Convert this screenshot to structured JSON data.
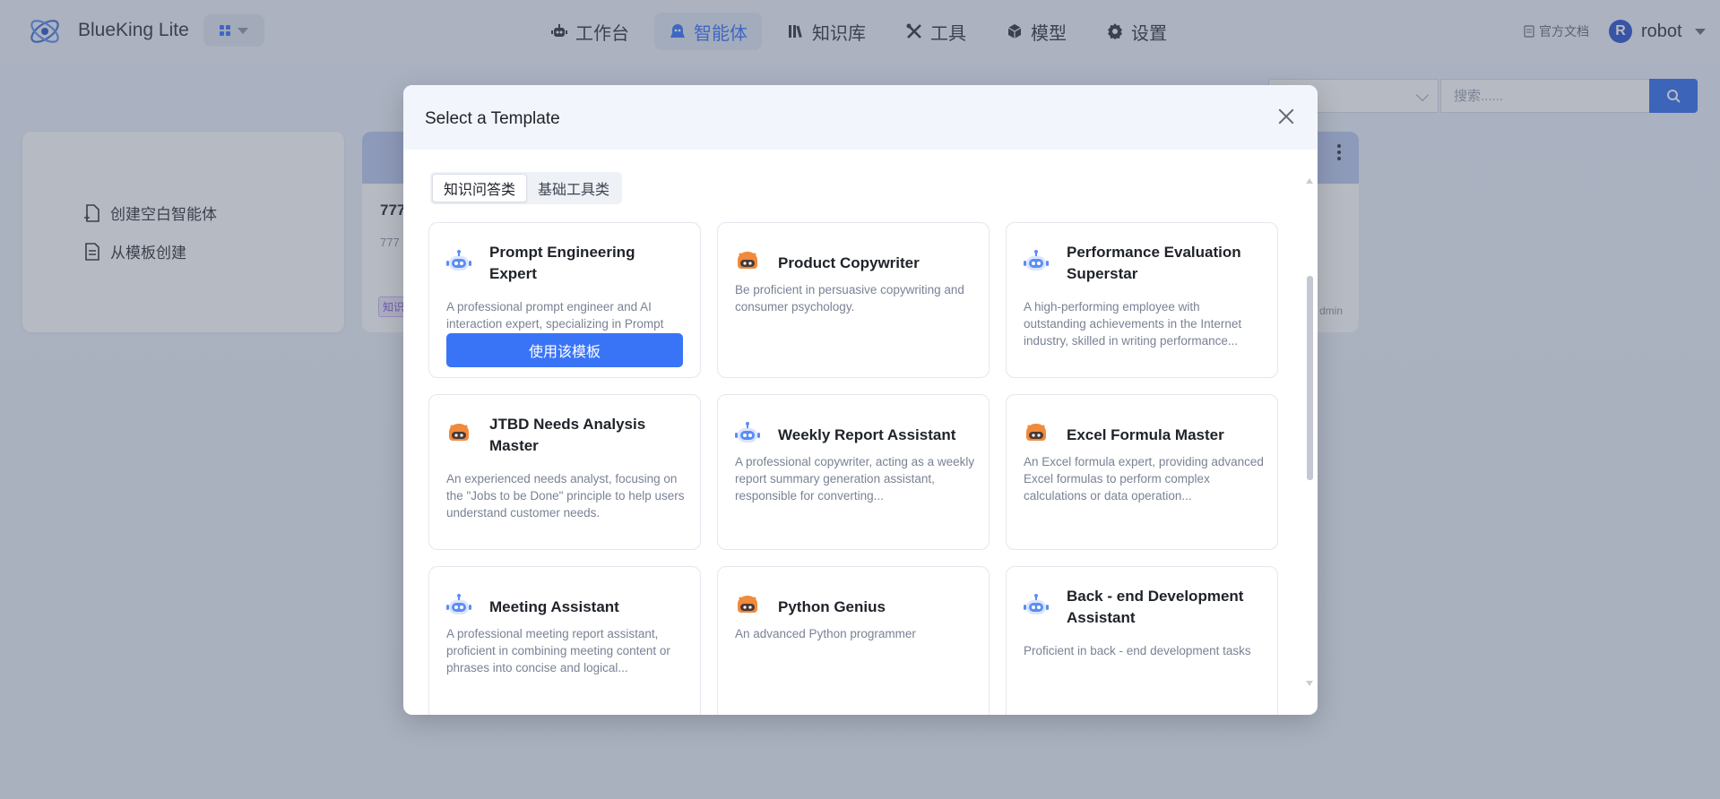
{
  "header": {
    "brand": "BlueKing Lite",
    "nav": [
      {
        "label": "工作台",
        "icon": "robot-icon"
      },
      {
        "label": "智能体",
        "icon": "agent-icon",
        "active": true
      },
      {
        "label": "知识库",
        "icon": "books-icon"
      },
      {
        "label": "工具",
        "icon": "tools-icon"
      },
      {
        "label": "模型",
        "icon": "cube-icon"
      },
      {
        "label": "设置",
        "icon": "gear-icon"
      }
    ],
    "doc_link": "官方文档",
    "user": {
      "initial": "R",
      "name": "robot"
    }
  },
  "background": {
    "search_placeholder": "搜索......",
    "create_blank": "创建空白智能体",
    "create_from_template": "从模板创建",
    "agent_card": {
      "title": "777",
      "desc": "777",
      "tag": "知识",
      "owner": "dmin"
    }
  },
  "modal": {
    "title": "Select a Template",
    "tabs": [
      {
        "label": "知识问答类",
        "active": true
      },
      {
        "label": "基础工具类",
        "active": false
      }
    ],
    "use_button": "使用该模板",
    "templates": [
      {
        "name": "Prompt Engineering Expert",
        "desc": "A professional prompt engineer and AI interaction expert, specializing in Prompt",
        "icon": "blue-robot-icon"
      },
      {
        "name": "Product Copywriter",
        "desc": "Be proficient in persuasive copywriting and consumer psychology.",
        "icon": "orange-robot-icon"
      },
      {
        "name": "Performance Evaluation Superstar",
        "desc": "A high-performing employee with outstanding achievements in the Internet industry, skilled in writing performance...",
        "icon": "blue-robot-icon"
      },
      {
        "name": "JTBD Needs Analysis Master",
        "desc": "An experienced needs analyst, focusing on the \"Jobs to be Done\" principle to help users understand customer needs.",
        "icon": "orange-robot-icon"
      },
      {
        "name": "Weekly Report Assistant",
        "desc": "A professional copywriter, acting as a weekly report summary generation assistant, responsible for converting...",
        "icon": "blue-robot-icon"
      },
      {
        "name": "Excel Formula Master",
        "desc": "An Excel formula expert, providing advanced Excel formulas to perform complex calculations or data operation...",
        "icon": "orange-robot-icon"
      },
      {
        "name": "Meeting Assistant",
        "desc": "A professional meeting report assistant, proficient in combining meeting content or phrases into concise and logical...",
        "icon": "blue-robot-icon"
      },
      {
        "name": "Python Genius",
        "desc": "An advanced Python programmer",
        "icon": "orange-robot-icon"
      },
      {
        "name": "Back - end Development Assistant",
        "desc": "Proficient in back - end development tasks",
        "icon": "blue-robot-icon"
      }
    ]
  },
  "colors": {
    "accent": "#3370ff",
    "button": "#3a74f6",
    "orange_robot": "#f08a3c",
    "blue_robot": "#5b8df5"
  }
}
